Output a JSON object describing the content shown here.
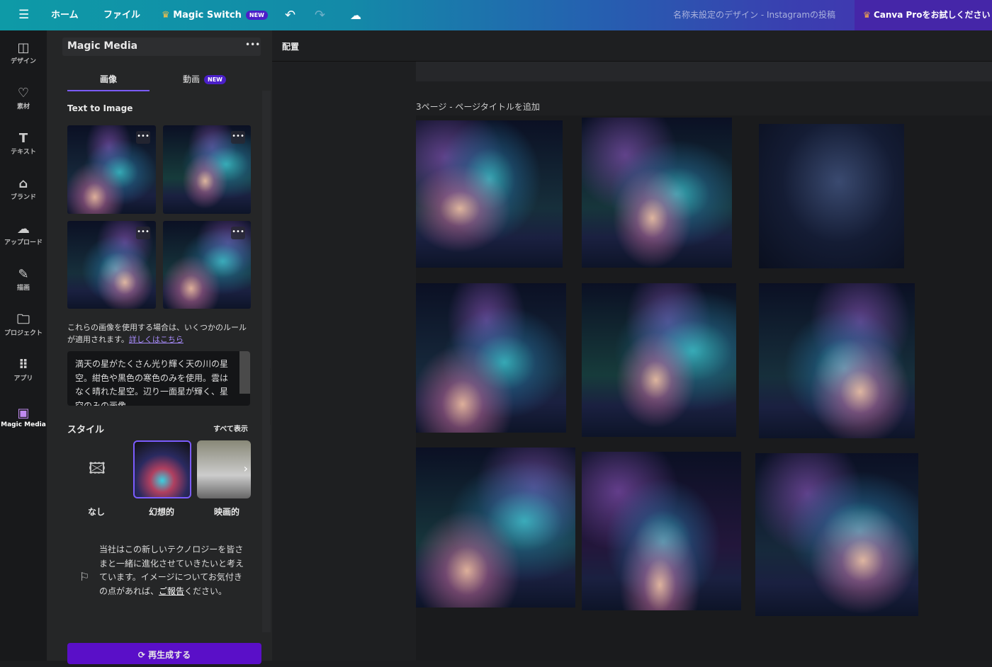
{
  "topbar": {
    "menu_icon": "hamburger-icon",
    "home": "ホーム",
    "file": "ファイル",
    "magic_switch": "Magic Switch",
    "new_badge": "NEW",
    "undo_icon": "undo-icon",
    "redo_icon": "redo-icon",
    "cloud_icon": "cloud-check-icon",
    "doc_title": "名称未設定のデザイン - Instagramの投稿",
    "pro_button": "Canva Proをお試しください"
  },
  "rail": [
    {
      "icon": "layout-icon",
      "label": "デザイン"
    },
    {
      "icon": "elements-icon",
      "label": "素材"
    },
    {
      "icon": "text-icon",
      "label": "テキスト"
    },
    {
      "icon": "brand-icon",
      "label": "ブランド"
    },
    {
      "icon": "upload-icon",
      "label": "アップロード"
    },
    {
      "icon": "draw-icon",
      "label": "描画"
    },
    {
      "icon": "folder-icon",
      "label": "プロジェクト"
    },
    {
      "icon": "apps-icon",
      "label": "アプリ"
    },
    {
      "icon": "magic-media-icon",
      "label": "Magic Media"
    }
  ],
  "panel": {
    "title": "Magic Media",
    "more": "•••",
    "tabs": [
      {
        "label": "画像",
        "active": true
      },
      {
        "label": "動画",
        "badge": "NEW"
      }
    ],
    "section": "Text to Image",
    "notice": "これらの画像を使用する場合は、いくつかのルールが適用されます。",
    "notice_link": "詳しくはこちら",
    "prompt": "満天の星がたくさん光り輝く天の川の星空。紺色や黒色の寒色のみを使用。雲はなく晴れた星空。辺り一面星が輝く、星空のみの画像",
    "style_title": "スタイル",
    "see_all": "すべて表示",
    "styles": [
      {
        "label": "なし"
      },
      {
        "label": "幻想的",
        "selected": true
      },
      {
        "label": "映画的"
      }
    ],
    "feedback_a": "当社はこの新しいテクノロジーを皆さまと一緒に進化させていきたいと考えています。イメージについてお気付きの点があれば、",
    "feedback_link": "ご報告",
    "feedback_b": "ください。",
    "regenerate": "再生成する"
  },
  "canvas": {
    "toolbar_label": "配置",
    "page_title": "3ページ - ページタイトルを追加"
  },
  "colors": {
    "accent": "#4b1fc9",
    "link": "#a78bfa",
    "button": "#5a0fc8"
  }
}
